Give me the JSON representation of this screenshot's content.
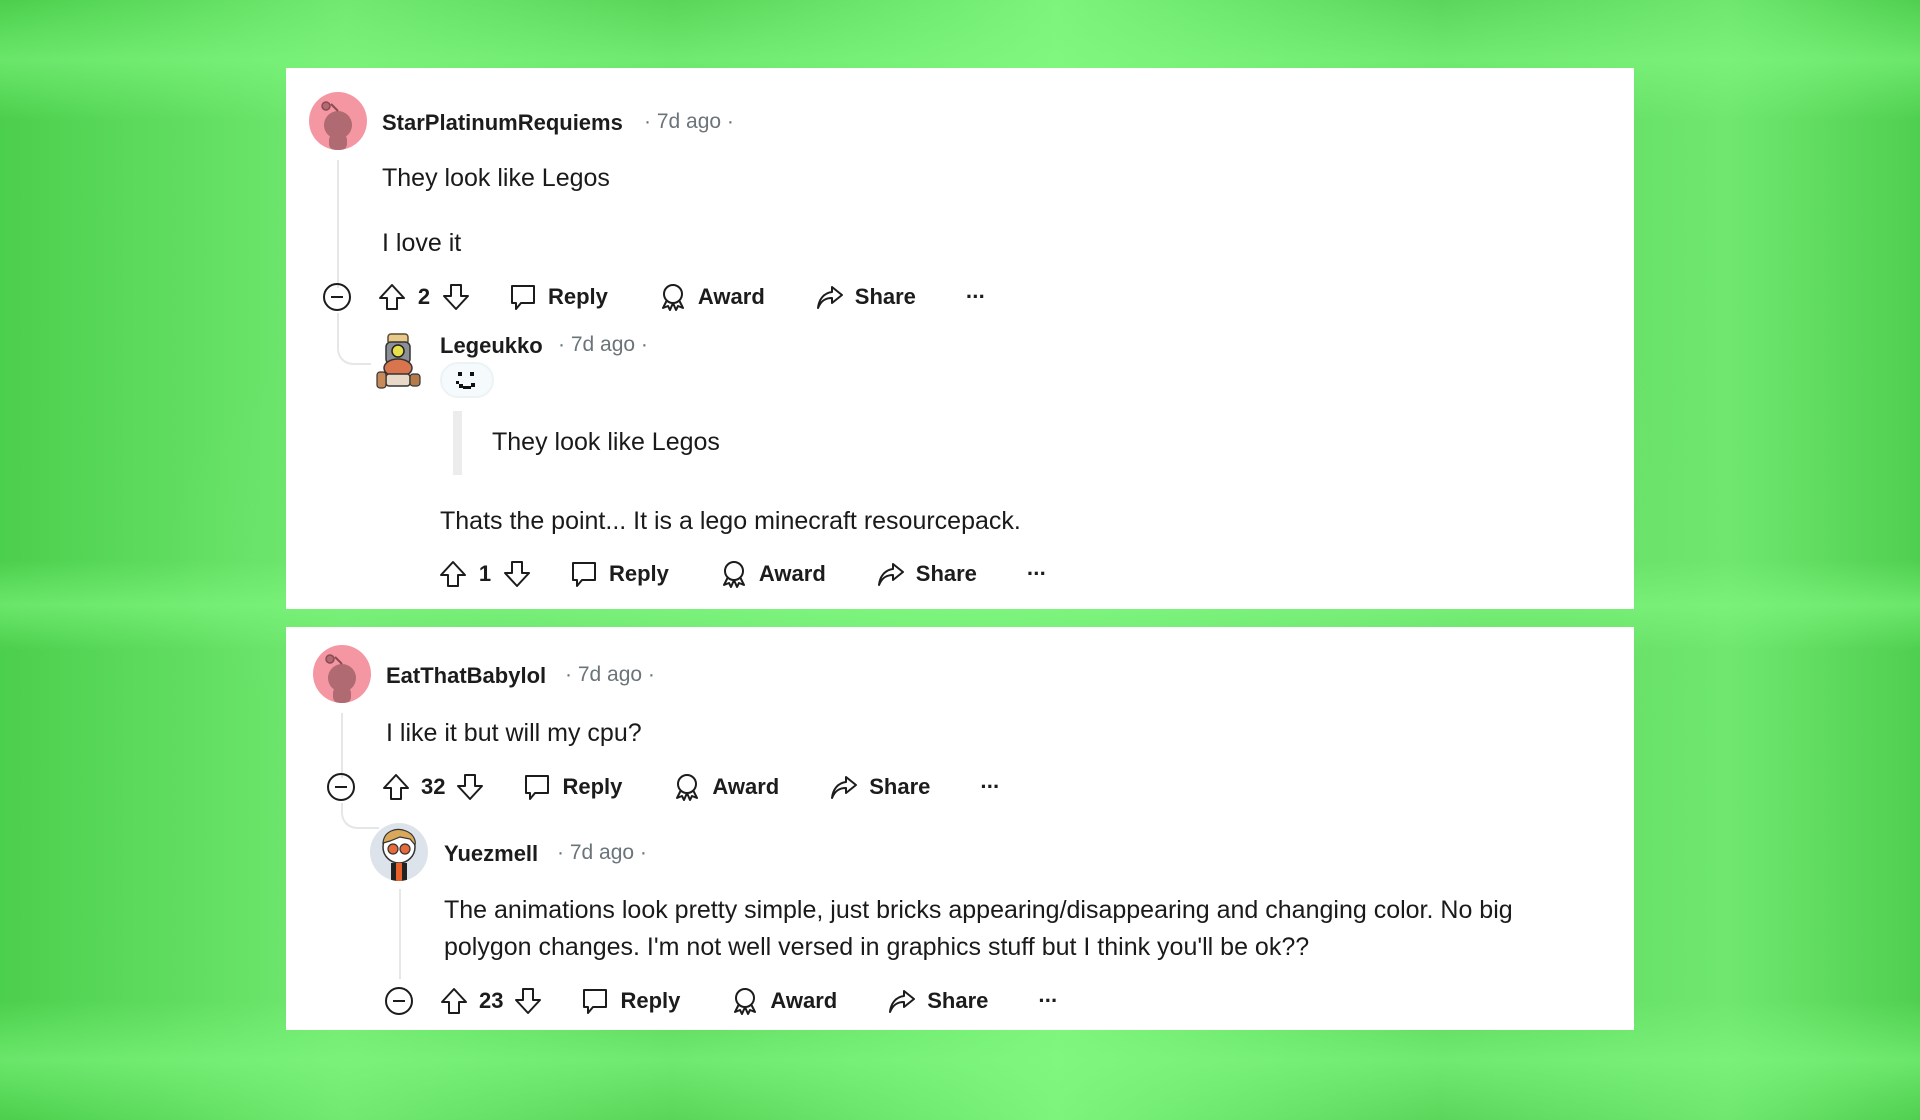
{
  "comments": [
    {
      "username": "StarPlatinumRequiems",
      "time": "7d ago",
      "avatar": "snoo-default-avatar",
      "paragraphs": [
        "They look like Legos",
        "I love it"
      ],
      "score": "2",
      "actions": {
        "reply": "Reply",
        "award": "Award",
        "share": "Share",
        "more": "···"
      },
      "replies": [
        {
          "username": "Legeukko",
          "time": "7d ago",
          "avatar": "custom-character-avatar",
          "flair_emote": "pixel-smiley-emote",
          "quote": "They look like Legos",
          "text": "Thats the point... It is a lego minecraft resourcepack.",
          "score": "1",
          "actions": {
            "reply": "Reply",
            "award": "Award",
            "share": "Share",
            "more": "···"
          }
        }
      ]
    },
    {
      "username": "EatThatBabylol",
      "time": "7d ago",
      "avatar": "snoo-default-avatar",
      "paragraphs": [
        "I like it but will my cpu?"
      ],
      "score": "32",
      "actions": {
        "reply": "Reply",
        "award": "Award",
        "share": "Share",
        "more": "···"
      },
      "replies": [
        {
          "username": "Yuezmell",
          "time": "7d ago",
          "avatar": "custom-character-avatar",
          "text": "The animations look pretty simple, just bricks appearing/disappearing and changing color. No big polygon changes. I'm not well versed in graphics stuff but I think you'll be ok??",
          "score": "23",
          "actions": {
            "reply": "Reply",
            "award": "Award",
            "share": "Share",
            "more": "···"
          }
        }
      ]
    }
  ],
  "meta": {
    "separator": "·"
  },
  "colors": {
    "background_green": "#6fe56f",
    "card": "#ffffff",
    "snoo_pink": "#f497a3",
    "meta_gray": "#6a7479"
  }
}
